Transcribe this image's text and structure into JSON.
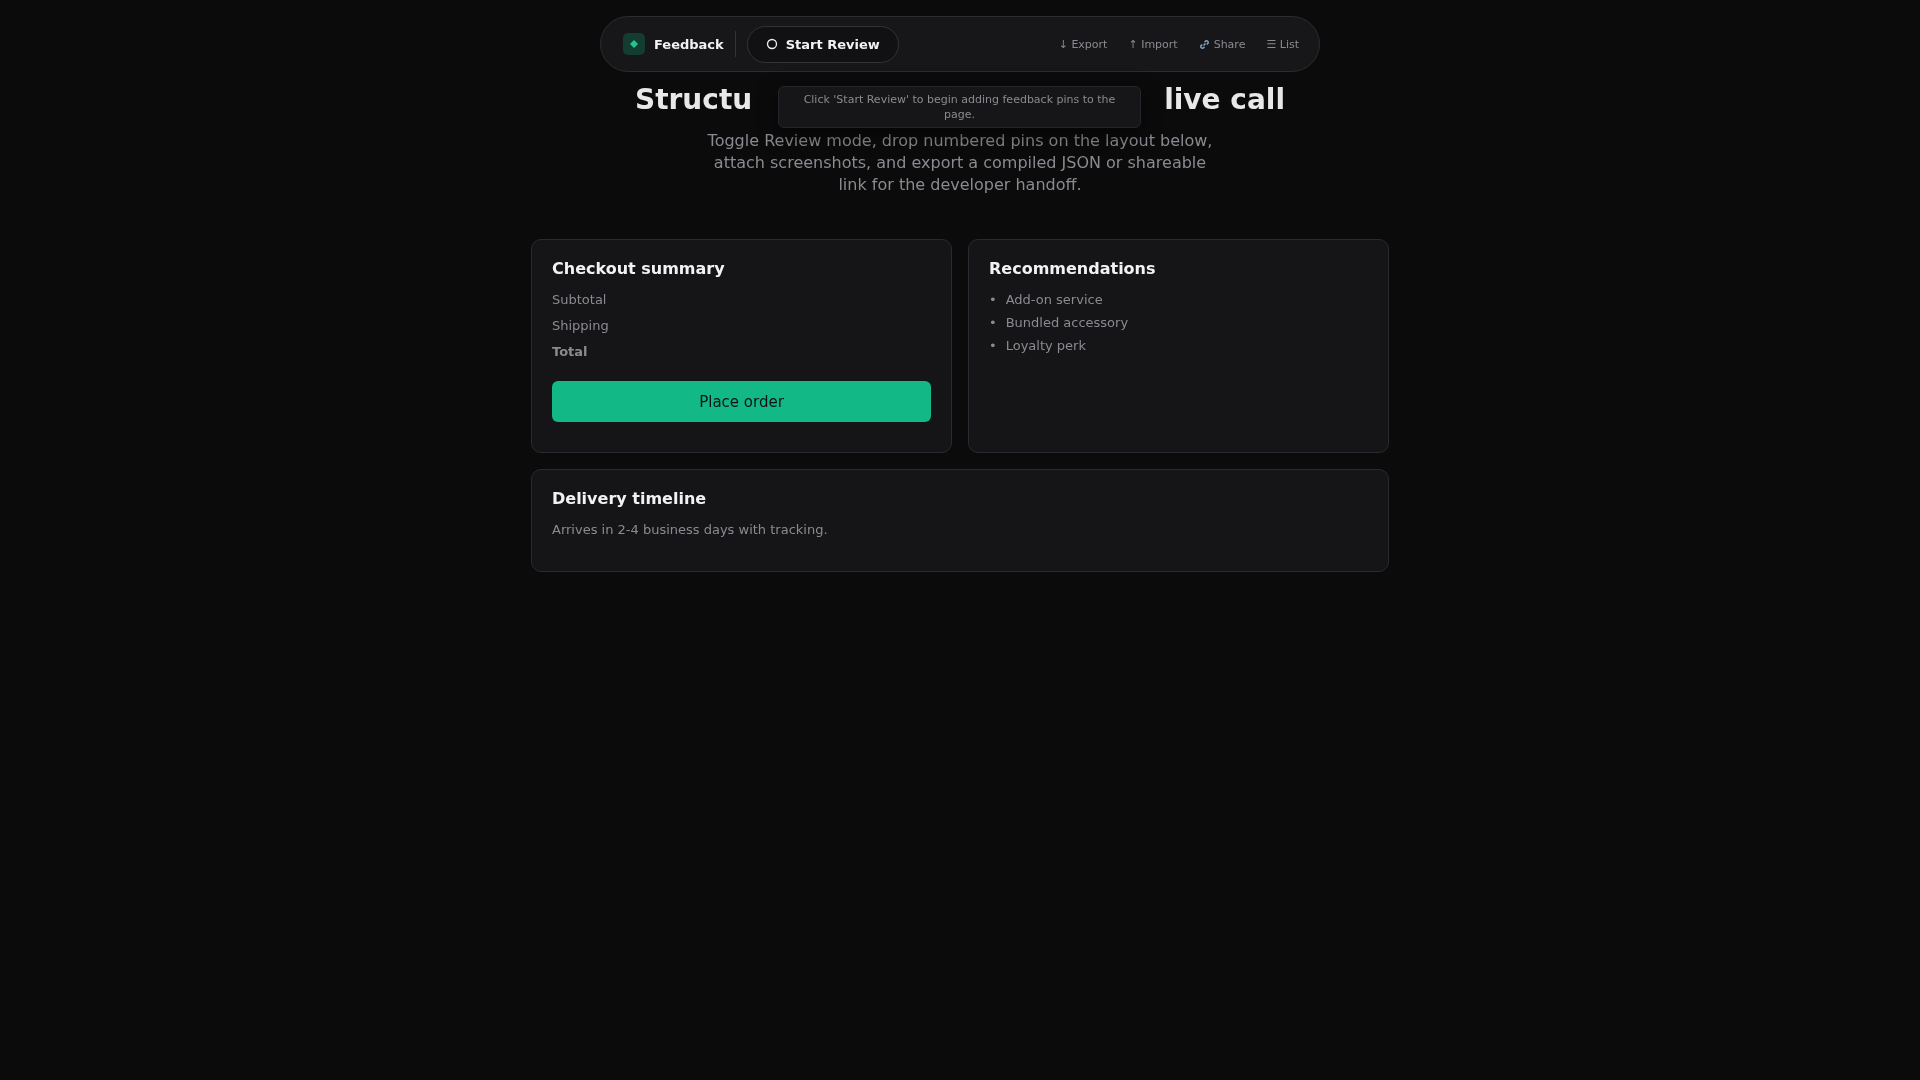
{
  "toolbar": {
    "brand": "Feedback",
    "review_button": "Start Review",
    "actions": [
      {
        "kind": "text",
        "label": "↓ Export"
      },
      {
        "kind": "text",
        "label": "↑ Import"
      },
      {
        "kind": "link",
        "label": "Share"
      },
      {
        "kind": "text",
        "label": "☰ List"
      }
    ]
  },
  "tooltip": "Click 'Start Review' to begin adding feedback pins to the page.",
  "hero": {
    "title_parts": [
      "Structu",
      "live call"
    ],
    "subtitle": "Toggle Review mode, drop numbered pins on the layout below, attach screenshots, and export a compiled JSON or shareable link for the developer handoff."
  },
  "checkout": {
    "title": "Checkout summary",
    "lines": [
      {
        "label": "Subtotal",
        "bold": false
      },
      {
        "label": "Shipping",
        "bold": false
      },
      {
        "label": "Total",
        "bold": true
      }
    ],
    "button": "Place order"
  },
  "recommendations": {
    "title": "Recommendations",
    "items": [
      {
        "bullet": "•",
        "label": "Add-on service"
      },
      {
        "bullet": "•",
        "label": "Bundled accessory"
      },
      {
        "bullet": "•",
        "label": "Loyalty perk"
      }
    ]
  },
  "delivery": {
    "title": "Delivery timeline",
    "text": "Arrives in 2-4 business days with tracking."
  }
}
